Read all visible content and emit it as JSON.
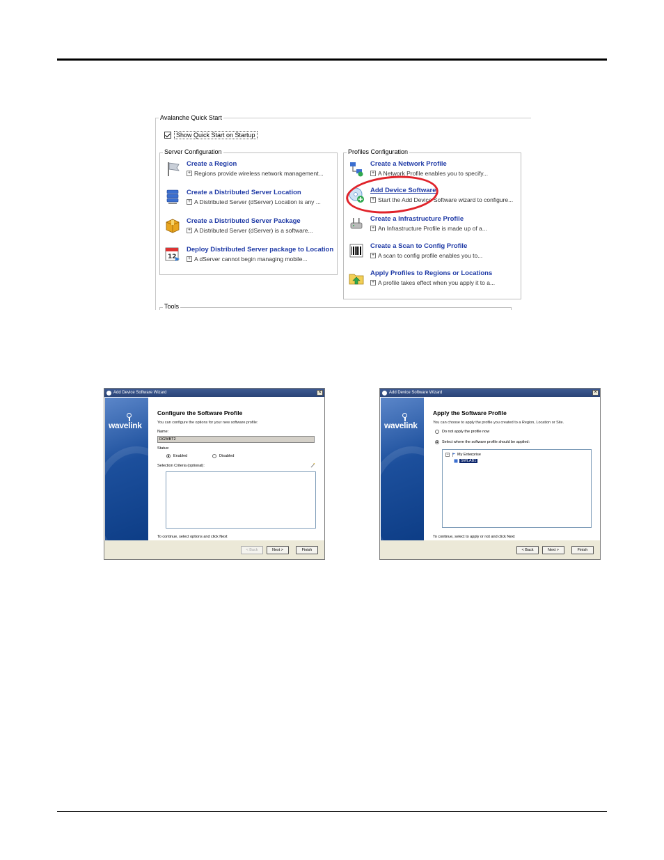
{
  "quick_start": {
    "title": "Avalanche Quick Start",
    "show_on_startup": "Show Quick Start on Startup",
    "server_configuration": {
      "title": "Server Configuration",
      "items": [
        {
          "label": "Create a Region",
          "desc": "Regions provide wireless network management..."
        },
        {
          "label": "Create a Distributed Server Location",
          "desc": "A Distributed Server (dServer) Location is any ..."
        },
        {
          "label": "Create a Distributed Server Package",
          "desc": "A Distributed Server (dServer) is a software..."
        },
        {
          "label": "Deploy Distributed Server package to Location",
          "desc": "A dServer cannot begin managing mobile..."
        }
      ]
    },
    "profiles_configuration": {
      "title": "Profiles Configuration",
      "items": [
        {
          "label": "Create a Network Profile",
          "desc": "A Network Profile enables you to specify..."
        },
        {
          "label": "Add Device Software",
          "desc": "Start the Add Device Software wizard to configure..."
        },
        {
          "label": "Create a Infrastructure Profile",
          "desc": "An Infrastructure Profile is made up of a..."
        },
        {
          "label": "Create a Scan to Config Profile",
          "desc": "A scan to config profile enables you to..."
        },
        {
          "label": "Apply Profiles to Regions or Locations",
          "desc": "A profile takes effect when you apply it to a..."
        }
      ]
    },
    "tools_title": "Tools",
    "highlight_color": "#e0232a"
  },
  "wizard_left": {
    "window_title": "Add Device Software Wizard",
    "logo": "wavelink",
    "heading": "Configure the Software Profile",
    "subtitle": "You can configure the options for your new software profile:",
    "name_label": "Name:",
    "name_value": "DGWBT2",
    "status_label": "Status:",
    "status_enabled": "Enabled",
    "status_disabled": "Disabled",
    "criteria_label": "Selection Criteria (optional):",
    "footnote": "To continue, select options and click Next",
    "buttons": {
      "back": "< Back",
      "next": "Next >",
      "finish": "Finish"
    }
  },
  "wizard_right": {
    "window_title": "Add Device Software Wizard",
    "logo": "wavelink",
    "heading": "Apply the Software Profile",
    "subtitle": "You can choose to apply the profile you created to a Region, Location or Site.",
    "option_no_apply": "Do not apply the profile now",
    "option_select": "Select where the software profile should be applied:",
    "tree": {
      "root": "My Enterprise",
      "child": "SWLAB1"
    },
    "footnote": "To continue, select to apply or not and click Next",
    "buttons": {
      "back": "< Back",
      "next": "Next >",
      "finish": "Finish"
    }
  }
}
